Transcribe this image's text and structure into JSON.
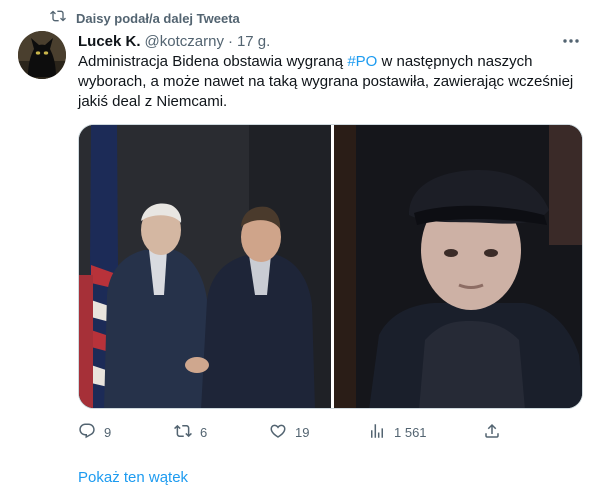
{
  "retweet": {
    "label": "Daisy podał/a dalej Tweeta",
    "icon": "retweet-icon"
  },
  "tweet": {
    "author_name": "Lucek K.",
    "author_handle": "@kotczarny",
    "separator": "·",
    "time": "17 g.",
    "text_before": "Administracja Bidena obstawia wygraną ",
    "hashtag": "#PO",
    "text_after": " w następnych naszych wyborach,  a może nawet na taką wygrana postawiła, zawierając wcześniej jakiś deal z Niemcami.",
    "more_icon": "more-horizontal-icon"
  },
  "actions": {
    "reply": {
      "icon": "reply-icon",
      "count": "9"
    },
    "retweet": {
      "icon": "retweet-icon",
      "count": "6"
    },
    "like": {
      "icon": "heart-icon",
      "count": "19"
    },
    "views": {
      "icon": "views-icon",
      "count": "1 561"
    },
    "share": {
      "icon": "share-icon"
    }
  },
  "show_thread": "Pokaż ten wątek",
  "colors": {
    "accent": "#1d9bf0",
    "secondary_text": "#536471",
    "primary_text": "#0f1419",
    "border": "#cfd9de"
  }
}
